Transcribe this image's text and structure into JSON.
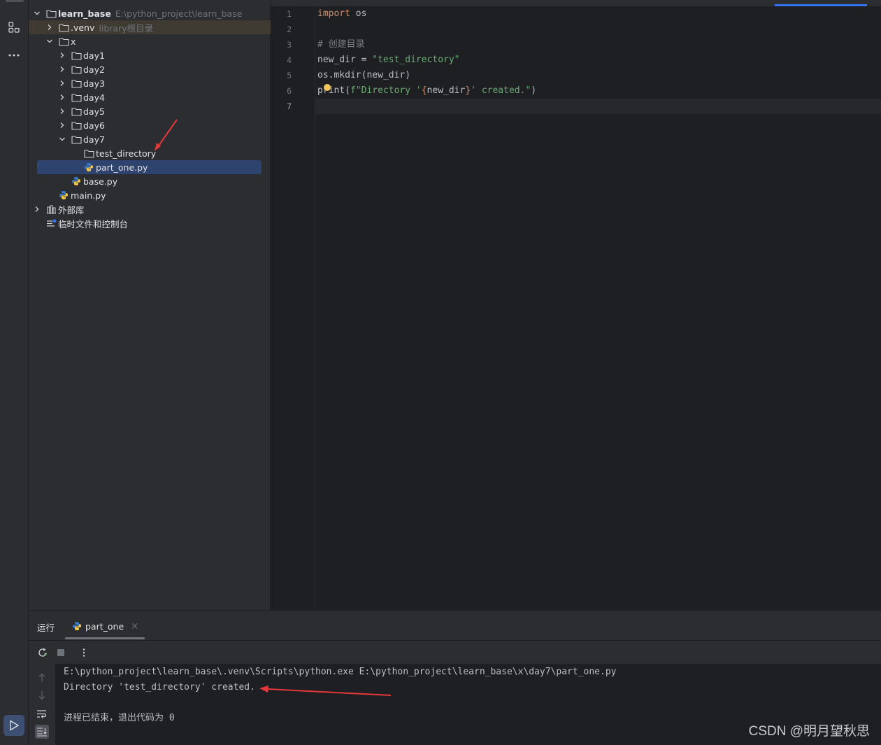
{
  "project": {
    "root_label": "learn_base",
    "root_path": "E:\\python_project\\learn_base",
    "venv_label": ".venv",
    "venv_hint": "library根目录",
    "x_label": "x",
    "days": [
      "day1",
      "day2",
      "day3",
      "day4",
      "day5",
      "day6",
      "day7"
    ],
    "test_dir_label": "test_directory",
    "part_one_label": "part_one.py",
    "base_label": "base.py",
    "main_label": "main.py",
    "ext_libs_label": "外部库",
    "scratches_label": "临时文件和控制台"
  },
  "editor": {
    "line_numbers": [
      "1",
      "2",
      "3",
      "4",
      "5",
      "6",
      "7"
    ],
    "code": {
      "l1_kw": "import",
      "l1_rest": " os",
      "l3_comment": "# 创建目录",
      "l4_var": "new_dir = ",
      "l4_str": "\"test_directory\"",
      "l5": "os.mkdir(new_dir)",
      "l6_a": "print(",
      "l6_fstr1": "f\"Directory '",
      "l6_brace_open": "{",
      "l6_expr": "new_dir",
      "l6_brace_close": "}",
      "l6_fstr2": "' created.\"",
      "l6_end": ")"
    }
  },
  "run": {
    "title": "运行",
    "tab_label": "part_one",
    "tab_close": "×",
    "console": [
      "E:\\python_project\\learn_base\\.venv\\Scripts\\python.exe E:\\python_project\\learn_base\\x\\day7\\part_one.py",
      "Directory 'test_directory' created.",
      "",
      "进程已结束，退出代码为 0"
    ]
  },
  "watermark": "CSDN @明月望秋思",
  "colors": {
    "annotation_arrow": "#e5383b",
    "selection": "#2e436e",
    "keyword": "#cf8e6d",
    "string": "#6aab73",
    "comment": "#7a7e85"
  }
}
